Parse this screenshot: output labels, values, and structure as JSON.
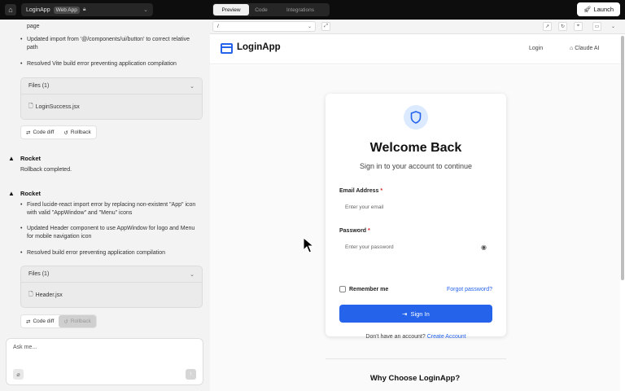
{
  "topbar": {
    "home_icon": "home-icon",
    "project_name": "LoginApp",
    "project_badge": "Web App",
    "tabs": [
      {
        "label": "Preview",
        "active": true
      },
      {
        "label": "Code",
        "active": false
      },
      {
        "label": "Integrations",
        "active": false
      }
    ],
    "launch_label": "Launch"
  },
  "chat": {
    "msg1_tail": "page",
    "msg1_bullets": [
      "Updated import from '@/components/ui/button' to correct relative path",
      "Resolved Vite build error preventing application compilation"
    ],
    "files1_header": "Files (1)",
    "files1_name": "LoginSuccess.jsx",
    "code_diff_label": "Code diff",
    "rollback_label": "Rollback",
    "msg2_author": "Rocket",
    "msg2_text": "Rollback completed.",
    "msg3_author": "Rocket",
    "msg3_bullets": [
      "Fixed lucide-react import error by replacing non-existent \"App\" icon with valid \"AppWindow\" and \"Menu\" icons",
      "Updated Header component to use AppWindow for logo and Menu for mobile navigation icon",
      "Resolved build error preventing application compilation"
    ],
    "files2_header": "Files (1)",
    "files2_name": "Header.jsx",
    "input_placeholder": "Ask me..."
  },
  "preview": {
    "url_value": "/",
    "app_logo": "LoginApp",
    "nav_login": "Login",
    "nav_claude": "Claude AI",
    "card_title": "Welcome Back",
    "card_subtitle": "Sign in to your account to continue",
    "email_label": "Email Address",
    "email_placeholder": "Enter your email",
    "password_label": "Password",
    "password_placeholder": "Enter your password",
    "required_mark": "*",
    "remember_label": "Remember me",
    "forgot_label": "Forgot password?",
    "signin_label": "Sign In",
    "signup_text": "Don't have an account?",
    "signup_link": "Create Account",
    "why_title": "Why Choose LoginApp?"
  },
  "colors": {
    "accent": "#2563eb",
    "required": "#dc2626",
    "topbar_bg": "#0d0d0d",
    "panel_bg": "#f3f3f3"
  }
}
